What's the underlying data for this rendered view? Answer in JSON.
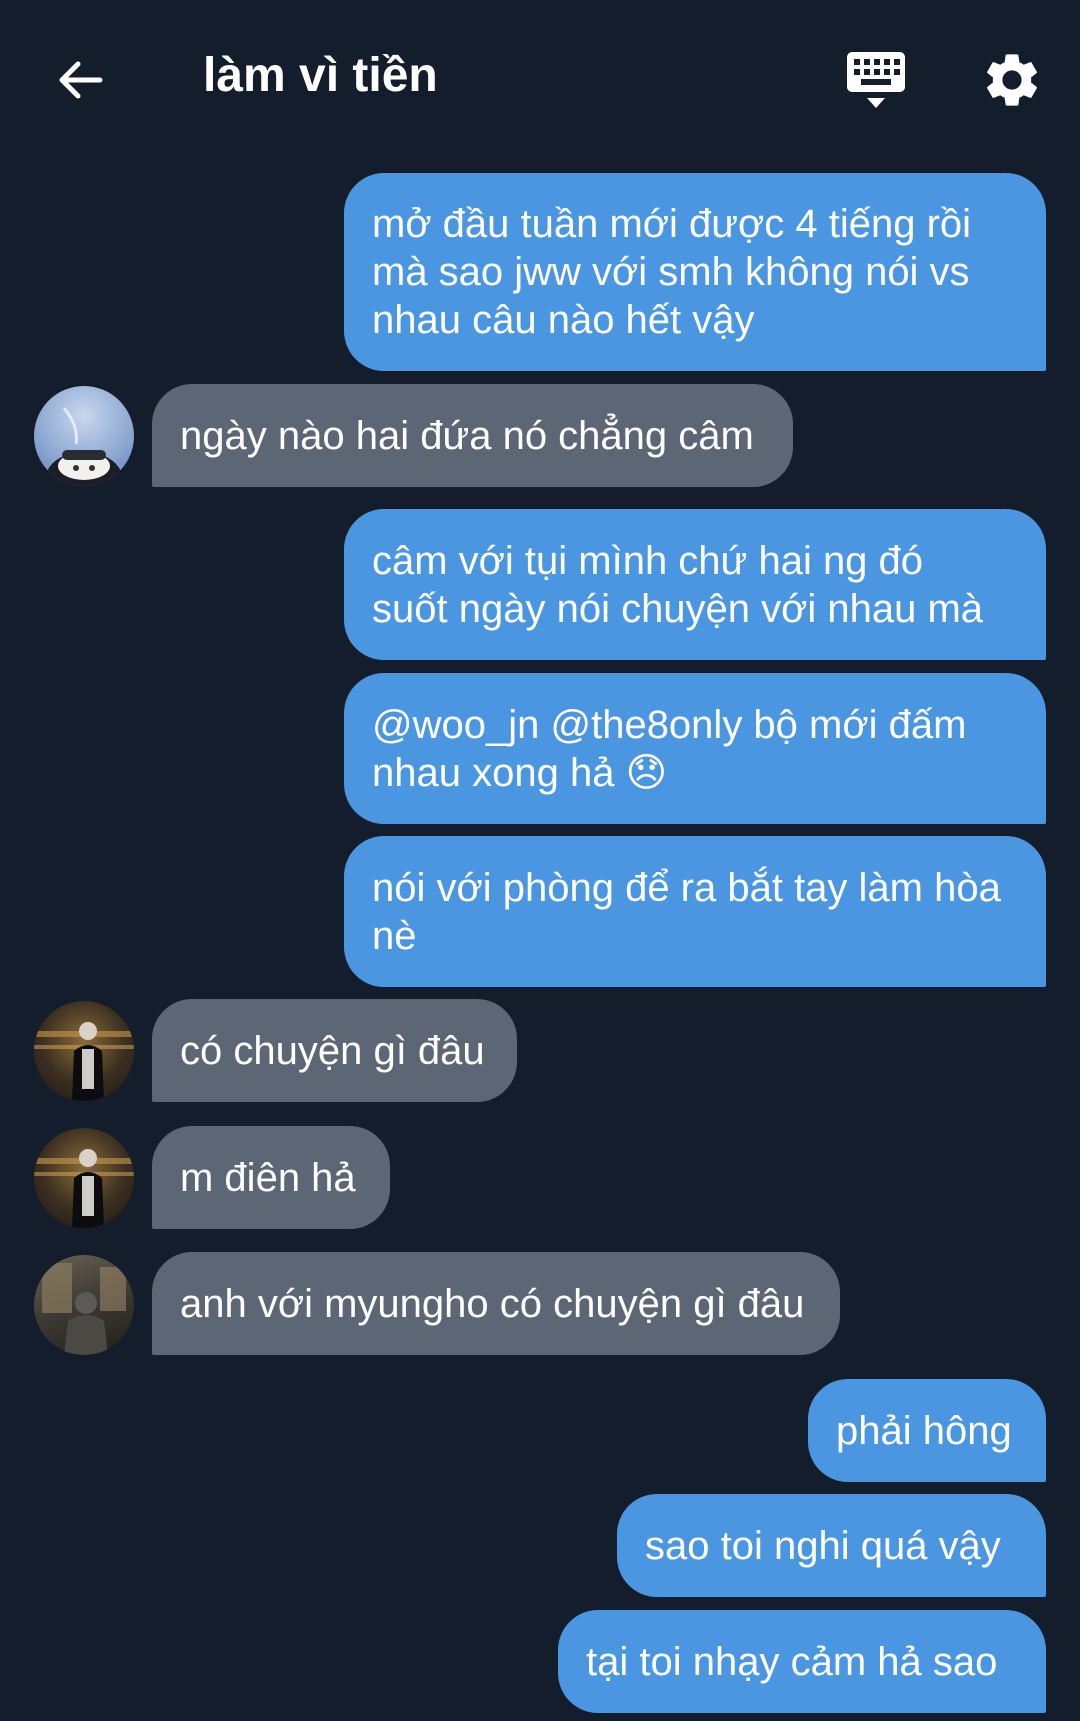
{
  "header": {
    "title": "làm vì tiền",
    "icons": {
      "back": "arrow-left-icon",
      "keyboard": "keyboard-icon",
      "settings": "gear-icon"
    }
  },
  "colors": {
    "background": "#141d2b",
    "outgoing_bubble": "#4a96e0",
    "incoming_bubble": "#5c6675",
    "text": "#ffffff"
  },
  "messages": [
    {
      "direction": "outgoing",
      "text": "mở đầu tuần mới được 4 tiếng rồi\nmà sao jww với smh không nói vs\nnhau câu nào hết vậy"
    },
    {
      "direction": "incoming",
      "avatar": "avatar-sky",
      "text": "ngày nào hai đứa nó chẳng câm"
    },
    {
      "direction": "outgoing",
      "text": "câm với tụi mình chứ hai ng đó\nsuốt ngày nói chuyện với nhau mà"
    },
    {
      "direction": "outgoing",
      "text": "@woo_jn @the8only bộ mới đấm\nnhau xong hả 😞"
    },
    {
      "direction": "outgoing",
      "text": "nói với phòng để ra bắt tay làm hòa\nnè"
    },
    {
      "direction": "incoming",
      "avatar": "avatar-night",
      "text": "có chuyện gì đâu"
    },
    {
      "direction": "incoming",
      "avatar": "avatar-night",
      "text": "m điên hả"
    },
    {
      "direction": "incoming",
      "avatar": "avatar-street",
      "text": "anh với myungho có chuyện gì đâu"
    },
    {
      "direction": "outgoing",
      "text": "phải hông"
    },
    {
      "direction": "outgoing",
      "text": "sao toi nghi quá vậy"
    },
    {
      "direction": "outgoing",
      "text": "tại toi nhạy cảm hả sao"
    }
  ]
}
